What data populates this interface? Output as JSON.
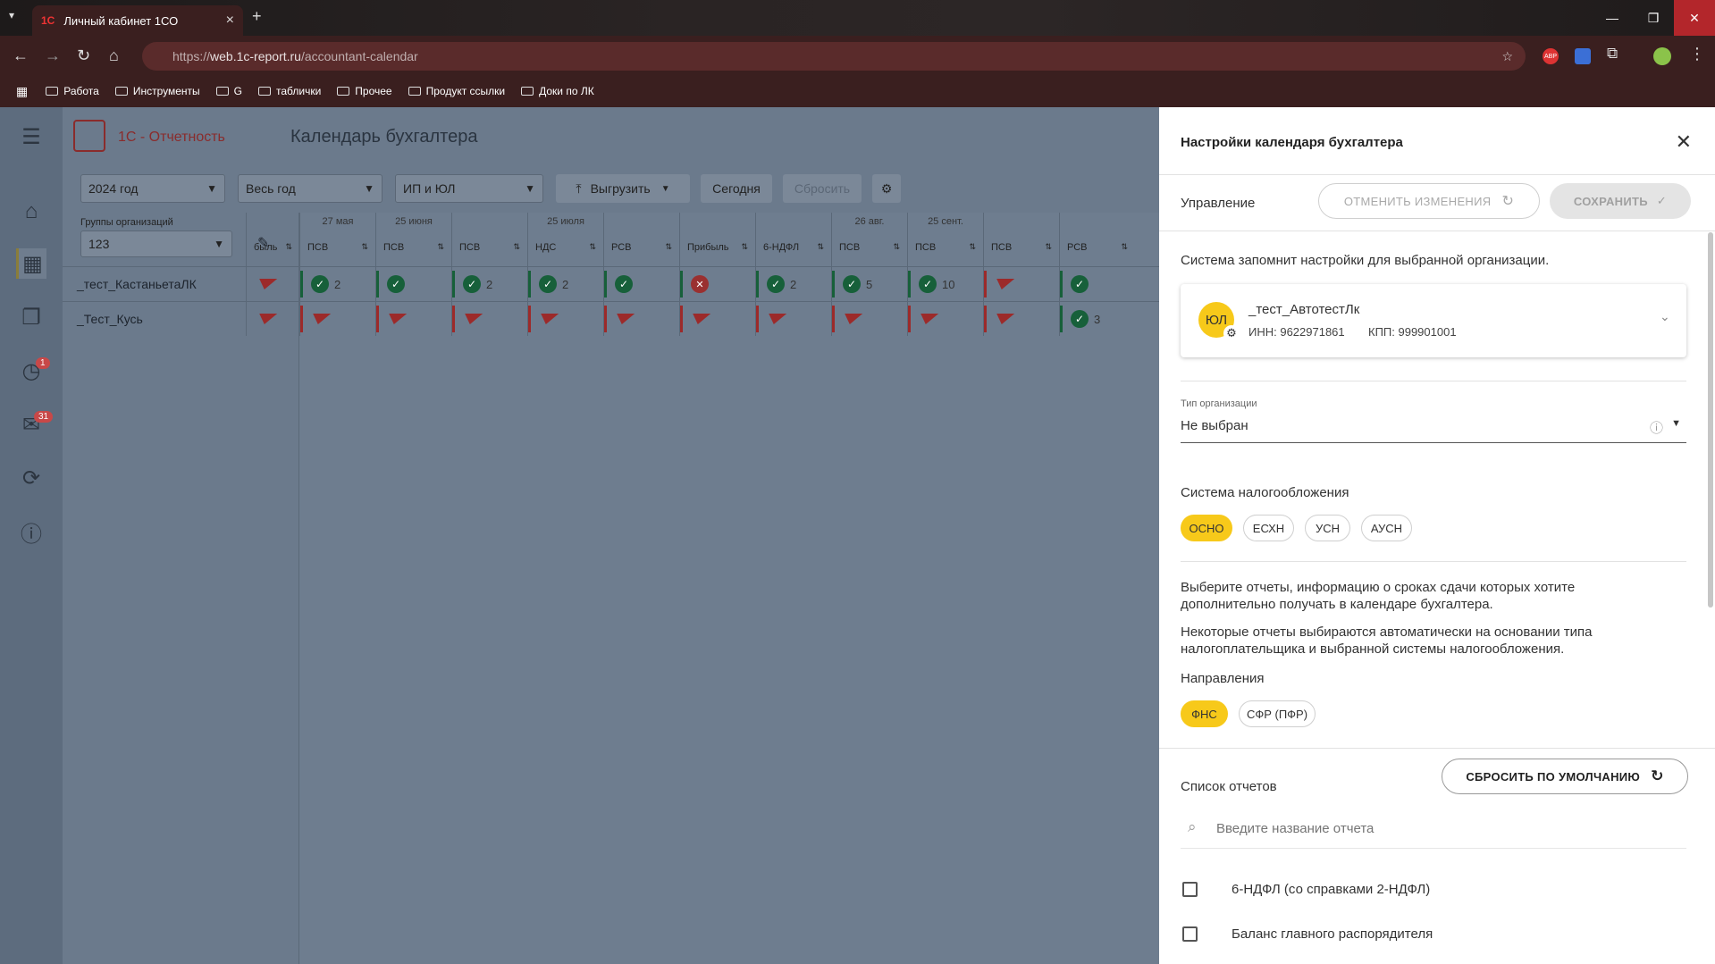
{
  "browser": {
    "tab_title": "Личный кабинет 1СО",
    "tab_favicon": "1С",
    "url_prefix": "https://",
    "url_host": "web.1c-report.ru",
    "url_path": "/accountant-calendar",
    "bookmarks": [
      "Работа",
      "Инструменты",
      "G",
      "таблички",
      "Прочее",
      "Продукт ссылки",
      "Доки по ЛК"
    ]
  },
  "app": {
    "logo": "1С - Отчетность",
    "page_title": "Календарь бухгалтера",
    "badges": {
      "notifications": "1",
      "messages": "31"
    },
    "toolbar": {
      "year": "2024 год",
      "period": "Весь год",
      "org_type": "ИП и ЮЛ",
      "export": "Выгрузить",
      "today": "Сегодня",
      "reset": "Сбросить"
    },
    "group_label": "Группы организаций",
    "group_value": "123",
    "columns": [
      {
        "date": "",
        "name": "быль"
      },
      {
        "date": "27 мая",
        "name": "ПСВ"
      },
      {
        "date": "25 июня",
        "name": "ПСВ"
      },
      {
        "date": "",
        "name": "ПСВ"
      },
      {
        "date": "25 июля",
        "name": "НДС"
      },
      {
        "date": "",
        "name": "РСВ"
      },
      {
        "date": "",
        "name": "Прибыль"
      },
      {
        "date": "",
        "name": "6-НДФЛ"
      },
      {
        "date": "26 авг.",
        "name": "ПСВ"
      },
      {
        "date": "25 сент.",
        "name": "ПСВ"
      },
      {
        "date": "",
        "name": "ПСВ"
      },
      {
        "date": "",
        "name": "РСВ"
      }
    ],
    "rows": [
      {
        "org": "_тест_КастаньетаЛК",
        "cells": [
          "",
          "2",
          "",
          "2",
          "2",
          "",
          "",
          "2",
          "5",
          "10",
          "",
          ""
        ]
      },
      {
        "org": "_Тест_Кусь",
        "cells": [
          "",
          "",
          "",
          "",
          "",
          "",
          "",
          "",
          "",
          "",
          "",
          "3"
        ]
      }
    ]
  },
  "panel": {
    "title": "Настройки календаря бухгалтера",
    "management_label": "Управление",
    "cancel_changes": "ОТМЕНИТЬ ИЗМЕНЕНИЯ",
    "save": "СОХРАНИТЬ",
    "memory_note": "Система запомнит настройки для выбранной организации.",
    "org": {
      "avatar": "ЮЛ",
      "name": "_тест_АвтотестЛк",
      "inn": "ИНН: 9622971861",
      "kpp": "КПП: 999901001"
    },
    "org_type_label": "Тип организации",
    "org_type_value": "Не выбран",
    "tax_label": "Система налогообложения",
    "tax_options": [
      "ОСНО",
      "ЕСХН",
      "УСН",
      "АУСН"
    ],
    "reports_note_1": "Выберите отчеты, информацию о сроках сдачи которых хотите дополнительно получать в календаре бухгалтера.",
    "reports_note_2": "Некоторые отчеты выбираются автоматически на основании типа налогоплательщика и выбранной системы налогообложения.",
    "directions_label": "Направления",
    "directions": [
      "ФНС",
      "СФР (ПФР)"
    ],
    "reports_list_label": "Список отчетов",
    "reset_default": "СБРОСИТЬ ПО УМОЛЧАНИЮ",
    "search_placeholder": "Введите название отчета",
    "reports": [
      "6-НДФЛ (со справками 2-НДФЛ)",
      "Баланс главного распорядителя"
    ]
  }
}
